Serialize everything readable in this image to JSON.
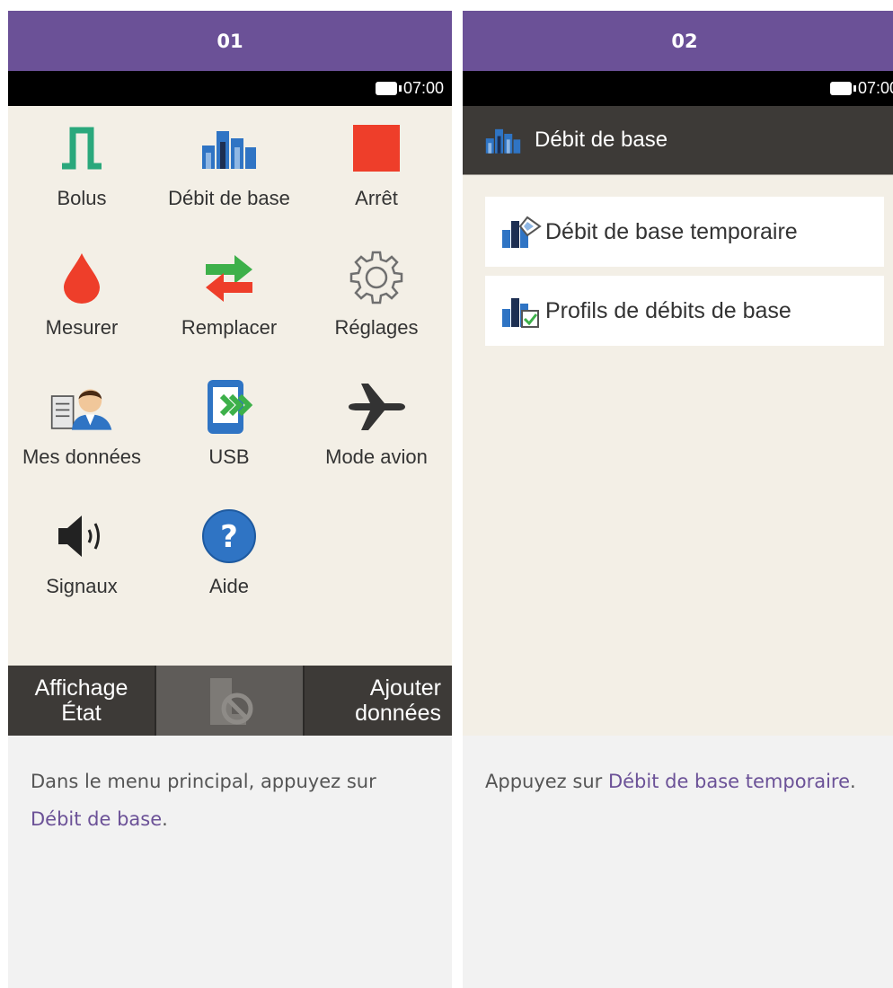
{
  "panels": [
    {
      "step": "01",
      "status": {
        "time": "07:00"
      },
      "menu": [
        {
          "label": "Bolus",
          "icon": "bolus-icon"
        },
        {
          "label": "Débit de base",
          "icon": "basal-rate-icon"
        },
        {
          "label": "Arrêt",
          "icon": "stop-icon"
        },
        {
          "label": "Mesurer",
          "icon": "blood-drop-icon"
        },
        {
          "label": "Remplacer",
          "icon": "replace-arrows-icon"
        },
        {
          "label": "Réglages",
          "icon": "gear-icon"
        },
        {
          "label": "Mes données",
          "icon": "my-data-icon"
        },
        {
          "label": "USB",
          "icon": "usb-icon"
        },
        {
          "label": "Mode avion",
          "icon": "airplane-icon"
        },
        {
          "label": "Signaux",
          "icon": "speaker-icon"
        },
        {
          "label": "Aide",
          "icon": "help-icon"
        }
      ],
      "bottom_bar": {
        "left": [
          "Affichage",
          "État"
        ],
        "right": [
          "Ajouter",
          "données"
        ],
        "middle_icon": "pump-disabled-icon"
      },
      "caption": {
        "text": "Dans le menu principal, appuyez sur ",
        "link": "Débit de base",
        "suffix": "."
      }
    },
    {
      "step": "02",
      "status": {
        "time": "07:00"
      },
      "title": "Débit de base",
      "title_icon": "basal-rate-icon",
      "menu": [
        {
          "label": "Débit de base temporaire",
          "icon": "temp-basal-icon"
        },
        {
          "label": "Profils de débits de base",
          "icon": "basal-profiles-icon"
        }
      ],
      "caption": {
        "text": "Appuyez sur ",
        "link": "Débit de base temporaire",
        "suffix": "."
      }
    }
  ],
  "colors": {
    "header": "#6b5197",
    "screen_bg": "#f3efe6",
    "bolus_green": "#2aa87c",
    "stop_red": "#ee3e2a",
    "link": "#6b5197"
  }
}
